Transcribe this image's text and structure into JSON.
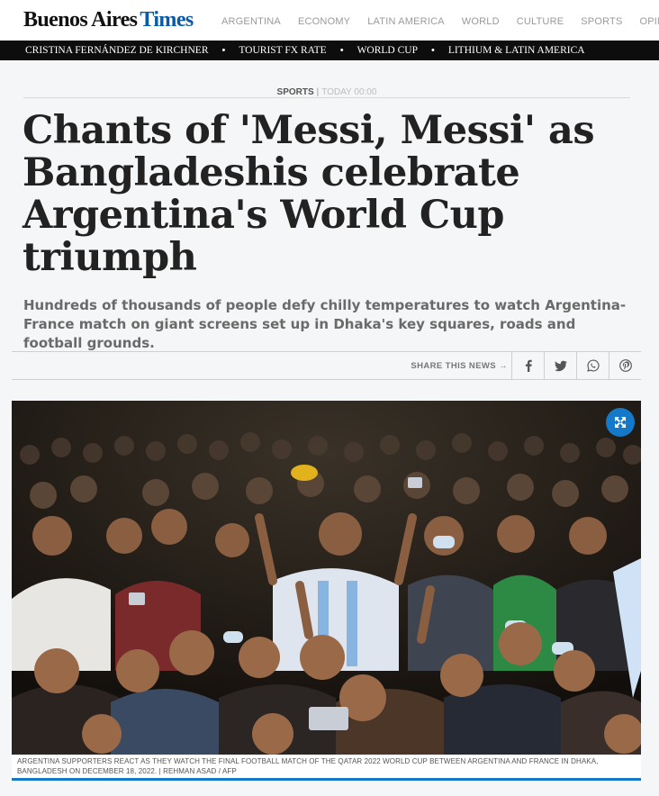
{
  "brand": {
    "name_part1": "Buenos Aires",
    "name_part2": "Times"
  },
  "main_nav": [
    "ARGENTINA",
    "ECONOMY",
    "LATIN AMERICA",
    "WORLD",
    "CULTURE",
    "SPORTS",
    "OPINION"
  ],
  "trending": [
    "CRISTINA FERNÁNDEZ DE KIRCHNER",
    "TOURIST FX RATE",
    "WORLD CUP",
    "LITHIUM & LATIN AMERICA"
  ],
  "article": {
    "section": "SPORTS",
    "separator": "|",
    "time": "TODAY 00:00",
    "headline": "Chants of 'Messi, Messi' as Bangladeshis celebrate Argentina's World Cup triumph",
    "subheadline": "Hundreds of thousands of people defy chilly temperatures to watch Argentina-France match on giant screens set up in Dhaka's key squares, roads and football grounds.",
    "caption": "ARGENTINA SUPPORTERS REACT AS THEY WATCH THE FINAL FOOTBALL MATCH OF THE QATAR 2022 WORLD CUP BETWEEN ARGENTINA AND FRANCE IN DHAKA, BANGLADESH ON DECEMBER 18, 2022. | REHMAN ASAD / AFP"
  },
  "share": {
    "label": "SHARE THIS NEWS",
    "arrow": "→",
    "buttons": [
      "facebook-icon",
      "twitter-icon",
      "whatsapp-icon",
      "pinterest-icon"
    ]
  },
  "colors": {
    "brand_blue": "#0a5aa8",
    "accent_blue": "#1479c9",
    "trending_bar": "#0d0d0d"
  }
}
